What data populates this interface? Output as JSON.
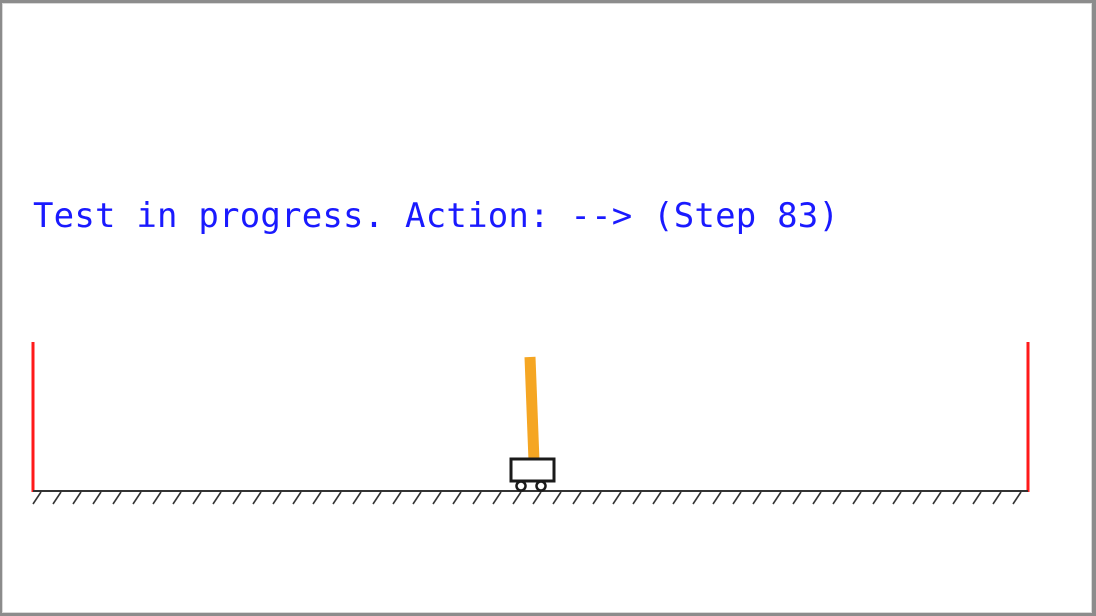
{
  "status": {
    "text": "Test in progress. Action: --> (Step 83)",
    "color": "#1a1aff"
  },
  "colors": {
    "boundary": "#ff1a1a",
    "pole": "#f5a623",
    "track": "#333333",
    "cart": "#1a1a1a",
    "background": "#ffffff"
  }
}
